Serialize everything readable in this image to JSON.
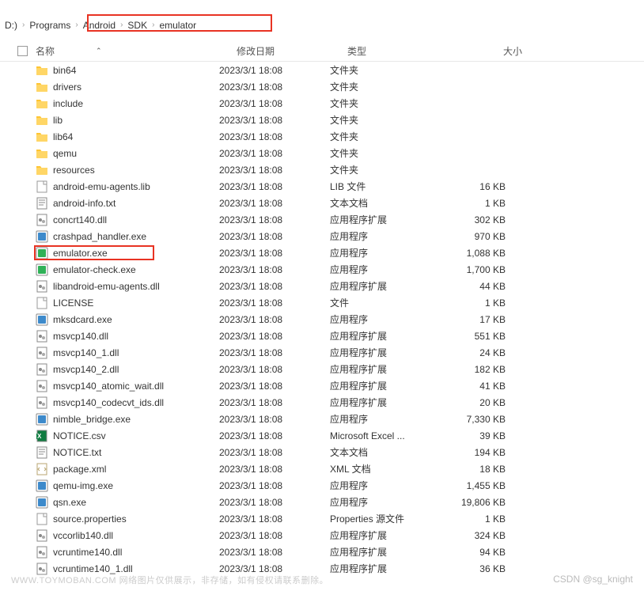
{
  "top_menu": {
    "a": "",
    "b": "",
    "c": ""
  },
  "breadcrumb": {
    "drive": "D:)",
    "segments": [
      "Programs",
      "Android",
      "SDK",
      "emulator"
    ]
  },
  "headers": {
    "name": "名称",
    "date": "修改日期",
    "type": "类型",
    "size": "大小"
  },
  "files": [
    {
      "icon": "folder",
      "name": "bin64",
      "date": "2023/3/1 18:08",
      "type": "文件夹",
      "size": ""
    },
    {
      "icon": "folder",
      "name": "drivers",
      "date": "2023/3/1 18:08",
      "type": "文件夹",
      "size": ""
    },
    {
      "icon": "folder",
      "name": "include",
      "date": "2023/3/1 18:08",
      "type": "文件夹",
      "size": ""
    },
    {
      "icon": "folder",
      "name": "lib",
      "date": "2023/3/1 18:08",
      "type": "文件夹",
      "size": ""
    },
    {
      "icon": "folder",
      "name": "lib64",
      "date": "2023/3/1 18:08",
      "type": "文件夹",
      "size": ""
    },
    {
      "icon": "folder",
      "name": "qemu",
      "date": "2023/3/1 18:08",
      "type": "文件夹",
      "size": ""
    },
    {
      "icon": "folder",
      "name": "resources",
      "date": "2023/3/1 18:08",
      "type": "文件夹",
      "size": ""
    },
    {
      "icon": "file",
      "name": "android-emu-agents.lib",
      "date": "2023/3/1 18:08",
      "type": "LIB 文件",
      "size": "16 KB"
    },
    {
      "icon": "txt",
      "name": "android-info.txt",
      "date": "2023/3/1 18:08",
      "type": "文本文档",
      "size": "1 KB"
    },
    {
      "icon": "dll",
      "name": "concrt140.dll",
      "date": "2023/3/1 18:08",
      "type": "应用程序扩展",
      "size": "302 KB"
    },
    {
      "icon": "exe-blue",
      "name": "crashpad_handler.exe",
      "date": "2023/3/1 18:08",
      "type": "应用程序",
      "size": "970 KB"
    },
    {
      "icon": "exe-green",
      "name": "emulator.exe",
      "date": "2023/3/1 18:08",
      "type": "应用程序",
      "size": "1,088 KB",
      "highlighted": true
    },
    {
      "icon": "exe-green",
      "name": "emulator-check.exe",
      "date": "2023/3/1 18:08",
      "type": "应用程序",
      "size": "1,700 KB"
    },
    {
      "icon": "dll",
      "name": "libandroid-emu-agents.dll",
      "date": "2023/3/1 18:08",
      "type": "应用程序扩展",
      "size": "44 KB"
    },
    {
      "icon": "file",
      "name": "LICENSE",
      "date": "2023/3/1 18:08",
      "type": "文件",
      "size": "1 KB"
    },
    {
      "icon": "exe-blue",
      "name": "mksdcard.exe",
      "date": "2023/3/1 18:08",
      "type": "应用程序",
      "size": "17 KB"
    },
    {
      "icon": "dll",
      "name": "msvcp140.dll",
      "date": "2023/3/1 18:08",
      "type": "应用程序扩展",
      "size": "551 KB"
    },
    {
      "icon": "dll",
      "name": "msvcp140_1.dll",
      "date": "2023/3/1 18:08",
      "type": "应用程序扩展",
      "size": "24 KB"
    },
    {
      "icon": "dll",
      "name": "msvcp140_2.dll",
      "date": "2023/3/1 18:08",
      "type": "应用程序扩展",
      "size": "182 KB"
    },
    {
      "icon": "dll",
      "name": "msvcp140_atomic_wait.dll",
      "date": "2023/3/1 18:08",
      "type": "应用程序扩展",
      "size": "41 KB"
    },
    {
      "icon": "dll",
      "name": "msvcp140_codecvt_ids.dll",
      "date": "2023/3/1 18:08",
      "type": "应用程序扩展",
      "size": "20 KB"
    },
    {
      "icon": "exe-blue",
      "name": "nimble_bridge.exe",
      "date": "2023/3/1 18:08",
      "type": "应用程序",
      "size": "7,330 KB"
    },
    {
      "icon": "csv",
      "name": "NOTICE.csv",
      "date": "2023/3/1 18:08",
      "type": "Microsoft Excel ...",
      "size": "39 KB"
    },
    {
      "icon": "txt",
      "name": "NOTICE.txt",
      "date": "2023/3/1 18:08",
      "type": "文本文档",
      "size": "194 KB"
    },
    {
      "icon": "xml",
      "name": "package.xml",
      "date": "2023/3/1 18:08",
      "type": "XML 文档",
      "size": "18 KB"
    },
    {
      "icon": "exe-blue",
      "name": "qemu-img.exe",
      "date": "2023/3/1 18:08",
      "type": "应用程序",
      "size": "1,455 KB"
    },
    {
      "icon": "exe-blue",
      "name": "qsn.exe",
      "date": "2023/3/1 18:08",
      "type": "应用程序",
      "size": "19,806 KB"
    },
    {
      "icon": "file",
      "name": "source.properties",
      "date": "2023/3/1 18:08",
      "type": "Properties 源文件",
      "size": "1 KB"
    },
    {
      "icon": "dll",
      "name": "vccorlib140.dll",
      "date": "2023/3/1 18:08",
      "type": "应用程序扩展",
      "size": "324 KB"
    },
    {
      "icon": "dll",
      "name": "vcruntime140.dll",
      "date": "2023/3/1 18:08",
      "type": "应用程序扩展",
      "size": "94 KB"
    },
    {
      "icon": "dll",
      "name": "vcruntime140_1.dll",
      "date": "2023/3/1 18:08",
      "type": "应用程序扩展",
      "size": "36 KB"
    }
  ],
  "watermark": {
    "left": "WWW.TOYMOBAN.COM  网络图片仅供展示，非存储，如有侵权请联系删除。",
    "right": "CSDN @sg_knight"
  }
}
